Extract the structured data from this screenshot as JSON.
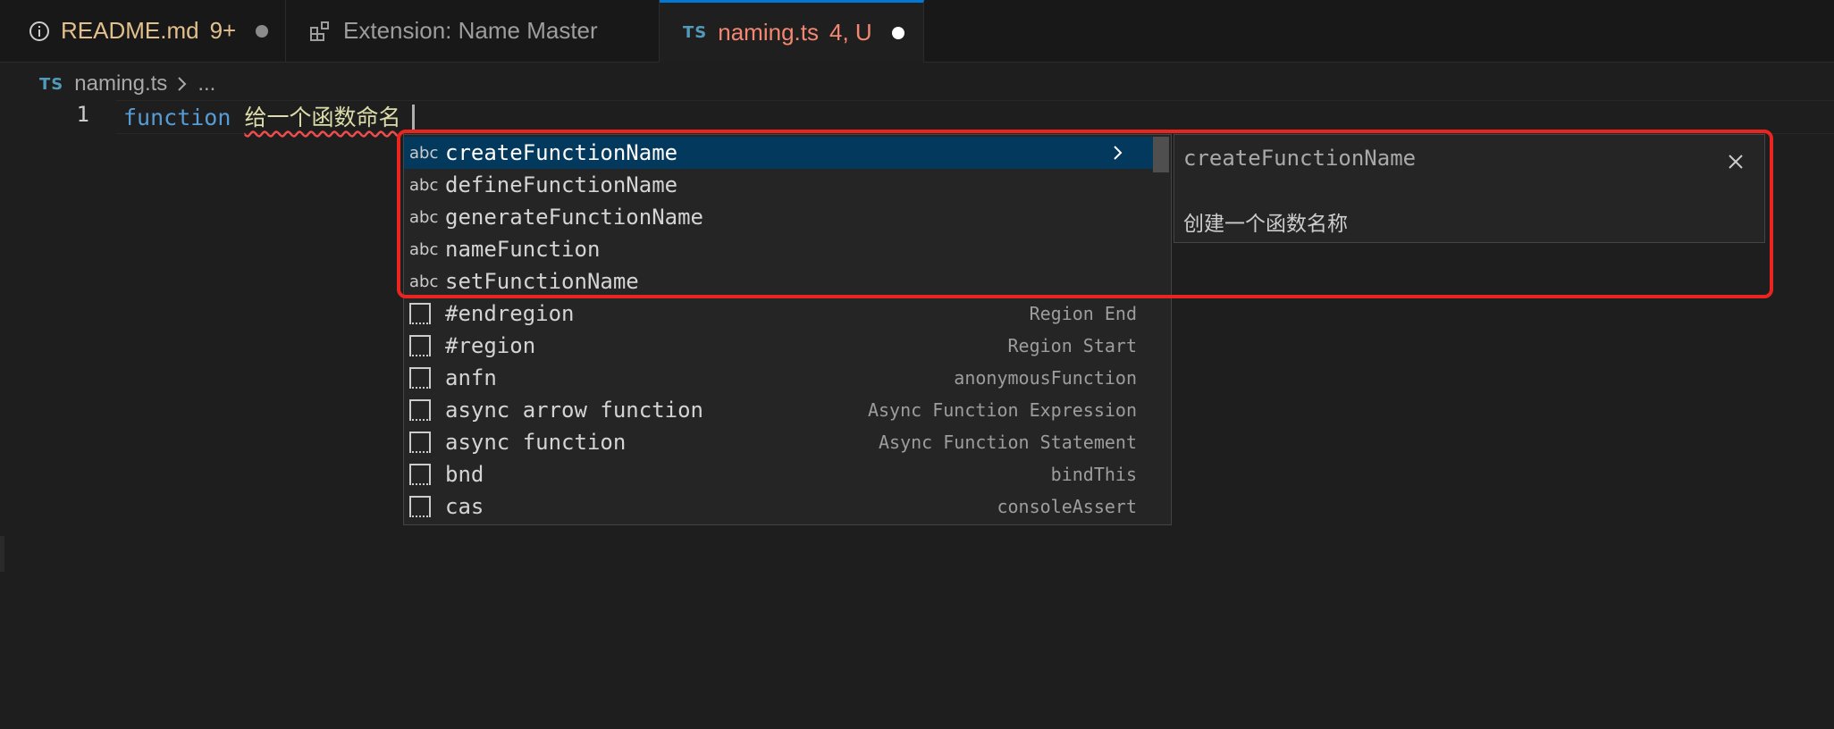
{
  "tabs": [
    {
      "label": "README.md",
      "badge": "9+",
      "icon": "info-icon"
    },
    {
      "label": "Extension: Name Master",
      "icon": "extensions-icon"
    },
    {
      "label": "naming.ts",
      "badge": "4, U",
      "icon": "ts-icon",
      "icon_text": "TS"
    }
  ],
  "breadcrumb": {
    "file_icon_text": "TS",
    "file": "naming.ts",
    "ellipsis": "..."
  },
  "editor": {
    "line_number": "1",
    "keyword": "function",
    "identifier": "给一个函数命名"
  },
  "suggest": {
    "items": [
      {
        "kind": "abc",
        "label": "createFunctionName",
        "detail": ""
      },
      {
        "kind": "abc",
        "label": "defineFunctionName",
        "detail": ""
      },
      {
        "kind": "abc",
        "label": "generateFunctionName",
        "detail": ""
      },
      {
        "kind": "abc",
        "label": "nameFunction",
        "detail": ""
      },
      {
        "kind": "abc",
        "label": "setFunctionName",
        "detail": ""
      },
      {
        "kind": "snippet",
        "label": "#endregion",
        "detail": "Region End"
      },
      {
        "kind": "snippet",
        "label": "#region",
        "detail": "Region Start"
      },
      {
        "kind": "snippet",
        "label": "anfn",
        "detail": "anonymousFunction"
      },
      {
        "kind": "snippet",
        "label": "async arrow function",
        "detail": "Async Function Expression"
      },
      {
        "kind": "snippet",
        "label": "async function",
        "detail": "Async Function Statement"
      },
      {
        "kind": "snippet",
        "label": "bnd",
        "detail": "bindThis"
      },
      {
        "kind": "snippet",
        "label": "cas",
        "detail": "consoleAssert"
      }
    ]
  },
  "details": {
    "title": "createFunctionName",
    "description": "创建一个函数名称"
  },
  "colors": {
    "highlight": "#e8261f",
    "selection": "#04395e",
    "active_tab_border": "#0078d4"
  }
}
